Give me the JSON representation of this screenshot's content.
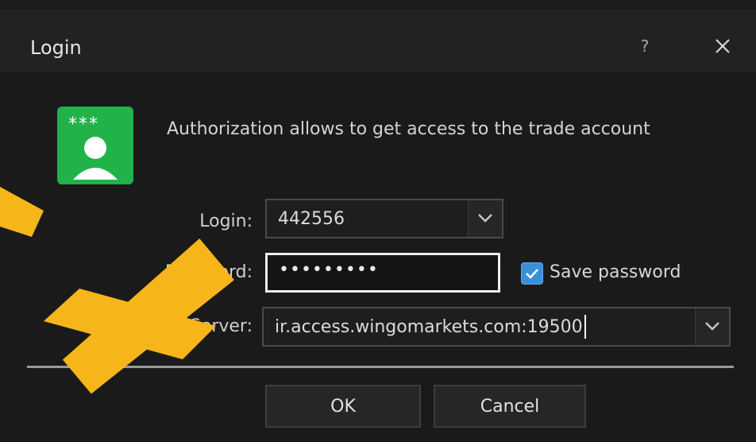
{
  "window": {
    "title": "Login",
    "help_label": "?"
  },
  "info_text": "Authorization allows to get access to the trade account",
  "app_icon_stars": "***",
  "form": {
    "login_label": "Login:",
    "login_value": "442556",
    "password_label": "Password:",
    "password_value": "•••••••••",
    "save_password_label": "Save password",
    "save_password_checked": true,
    "server_label": "Server:",
    "server_value": "ir.access.wingomarkets.com:19500"
  },
  "buttons": {
    "ok": "OK",
    "cancel": "Cancel"
  },
  "colors": {
    "arrow": "#f6b619",
    "icon_green": "#21b24a",
    "checkbox_blue": "#3a8fd8"
  }
}
